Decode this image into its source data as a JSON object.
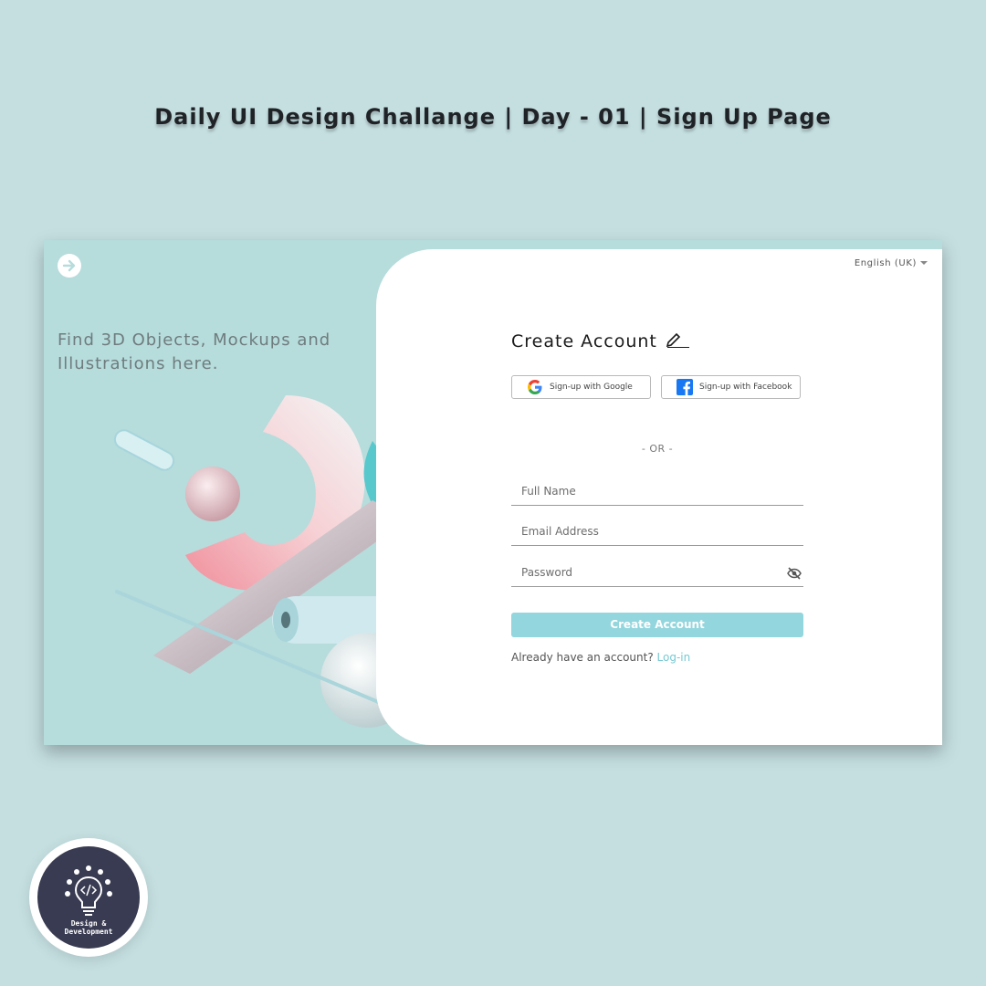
{
  "page_title": "Daily UI Design Challange | Day - 01 | Sign Up Page",
  "hero": {
    "tagline": "Find 3D Objects, Mockups and Illustrations here.",
    "logo_icon": "arrow-right-circle-icon"
  },
  "header": {
    "language": "English (UK)"
  },
  "form": {
    "title": "Create Account",
    "title_icon": "pencil-icon",
    "google_button": "Sign-up with Google",
    "facebook_button": "Sign-up with Facebook",
    "divider": "- OR -",
    "full_name_placeholder": "Full Name",
    "email_placeholder": "Email Address",
    "password_placeholder": "Password",
    "password_toggle_icon": "eye-off-icon",
    "submit_label": "Create Account",
    "login_prompt": "Already have an account?",
    "login_link": "Log-in"
  },
  "badge": {
    "line1": "Design &",
    "line2": "Development"
  },
  "colors": {
    "background": "#c5dfe1",
    "hero_panel": "#b6dcdb",
    "accent": "#93d6dd",
    "link": "#77c9d3",
    "badge": "#383b51"
  }
}
